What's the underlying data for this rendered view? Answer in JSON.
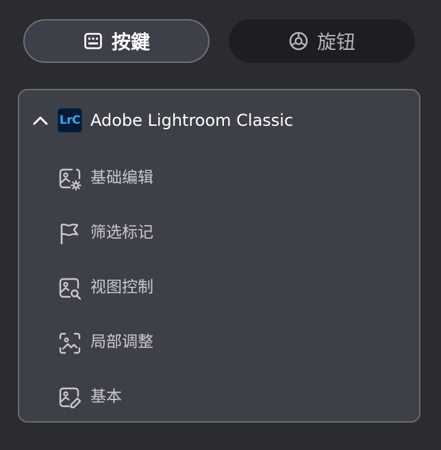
{
  "tabs": {
    "keys_label": "按鍵",
    "knob_label": "旋钮"
  },
  "app": {
    "logo_text": "LrC",
    "name": "Adobe Lightroom Classic"
  },
  "menu": {
    "items": [
      {
        "label": "基础编辑",
        "icon": "image-gear-icon"
      },
      {
        "label": "筛选标记",
        "icon": "flag-icon"
      },
      {
        "label": "视图控制",
        "icon": "image-search-icon"
      },
      {
        "label": "局部调整",
        "icon": "image-adjust-icon"
      },
      {
        "label": "基本",
        "icon": "image-edit-icon"
      }
    ]
  },
  "colors": {
    "background": "#2b2c30",
    "panel": "#3e4048",
    "active_tab": "#3e4049",
    "inactive_tab": "#1d1e21",
    "lrc_blue": "#31a8ff",
    "lrc_bg": "#061b33"
  }
}
